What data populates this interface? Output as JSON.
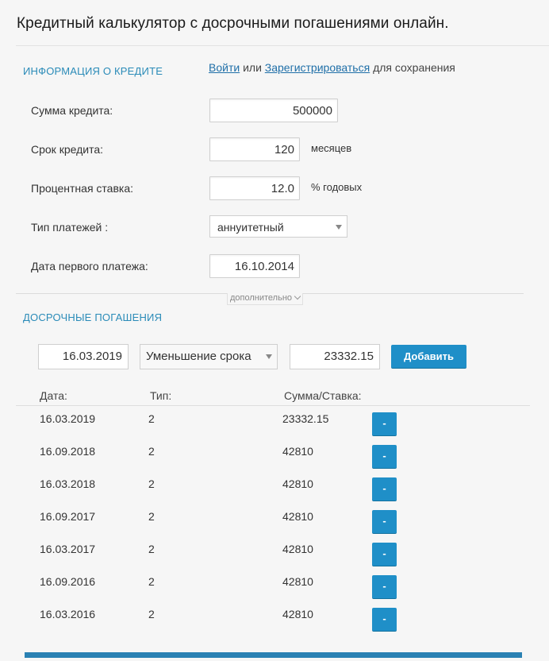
{
  "title": "Кредитный калькулятор с досрочными погашениями онлайн.",
  "info_section": {
    "heading": "ИНФОРМАЦИЯ О КРЕДИТЕ",
    "login_link": "Войти",
    "or_text": "или",
    "register_link": "Зарегистрироваться",
    "save_text": "для сохранения"
  },
  "form": {
    "amount_label": "Сумма кредита:",
    "amount_value": "500000",
    "term_label": "Срок кредита:",
    "term_value": "120",
    "term_unit": "месяцев",
    "rate_label": "Процентная ставка:",
    "rate_value": "12.0",
    "rate_unit": "% годовых",
    "payment_type_label": "Тип платежей :",
    "payment_type_value": "аннуитетный",
    "first_payment_label": "Дата первого платежа:",
    "first_payment_value": "16.10.2014",
    "more_label": "дополнительно"
  },
  "early": {
    "heading": "ДОСРОЧНЫЕ ПОГАШЕНИЯ",
    "date_value": "16.03.2019",
    "type_value": "Уменьшение срока",
    "amount_value": "23332.15",
    "add_label": "Добавить",
    "col_date": "Дата:",
    "col_type": "Тип:",
    "col_amount": "Сумма/Ставка:",
    "remove_label": "-",
    "rows": [
      {
        "date": "16.03.2019",
        "type": "2",
        "amount": "23332.15"
      },
      {
        "date": "16.09.2018",
        "type": "2",
        "amount": "42810"
      },
      {
        "date": "16.03.2018",
        "type": "2",
        "amount": "42810"
      },
      {
        "date": "16.09.2017",
        "type": "2",
        "amount": "42810"
      },
      {
        "date": "16.03.2017",
        "type": "2",
        "amount": "42810"
      },
      {
        "date": "16.09.2016",
        "type": "2",
        "amount": "42810"
      },
      {
        "date": "16.03.2016",
        "type": "2",
        "amount": "42810"
      }
    ]
  },
  "colors": {
    "accent": "#1f8fc8",
    "heading": "#2a8bb8",
    "link": "#1f6fa8"
  }
}
